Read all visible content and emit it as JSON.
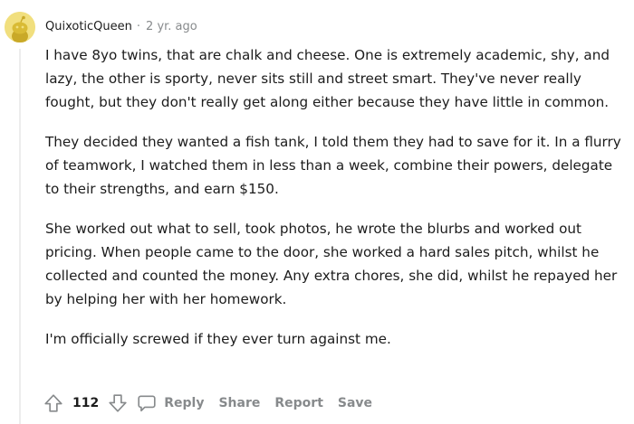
{
  "comment": {
    "username": "QuixoticQueen",
    "separator": "·",
    "timestamp": "2 yr. ago",
    "paragraphs": [
      "I have 8yo twins, that are chalk and cheese. One is extremely academic, shy, and lazy, the other is sporty, never sits still and street smart. They've never really fought, but they don't really get along either because they have little in common.",
      "They decided they wanted a fish tank, I told them they had to save for it. In a flurry of teamwork, I watched them in less than a week, combine their powers, delegate to their strengths, and earn $150.",
      "She worked out what to sell, took photos, he wrote the blurbs and worked out pricing. When people came to the door, she worked a hard sales pitch, whilst he collected and counted the money. Any extra chores, she did, whilst he repayed her by helping her with her homework.",
      "I'm officially screwed if they ever turn against me."
    ],
    "score": "112",
    "actions": {
      "reply": "Reply",
      "share": "Share",
      "report": "Report",
      "save": "Save"
    }
  },
  "icons": {
    "avatar": "snoo-avatar-icon",
    "upvote": "upvote-arrow-icon",
    "downvote": "downvote-arrow-icon",
    "reply": "comment-bubble-icon"
  },
  "colors": {
    "avatar_bg": "#f1df7e",
    "muted_text": "#878a8c",
    "body_text": "#1c1c1c",
    "thread_line": "#ededed"
  }
}
